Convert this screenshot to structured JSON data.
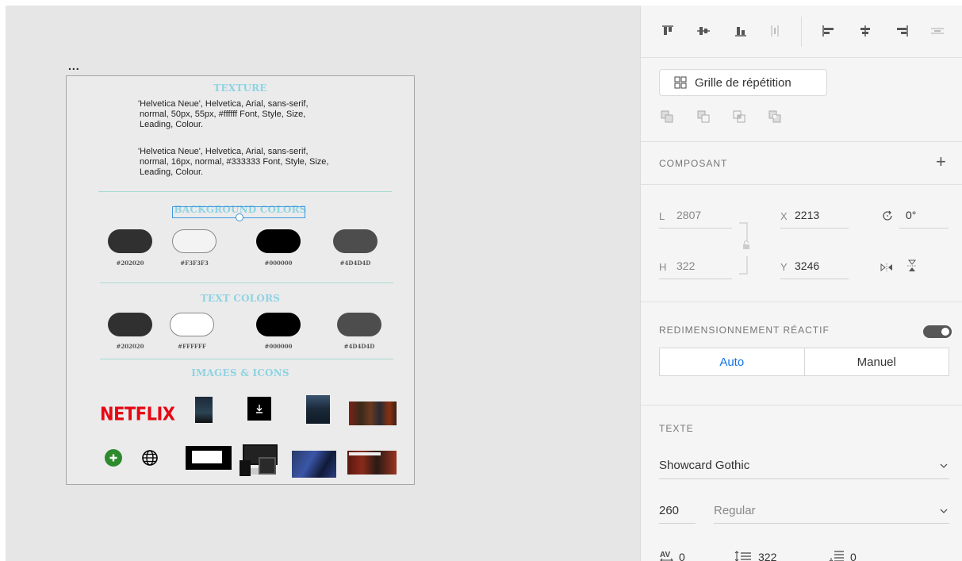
{
  "canvas": {
    "more_label": "...",
    "texture": {
      "title": "TEXTURE",
      "line1": "'Helvetica Neue', Helvetica, Arial, sans-serif,",
      "line2": "normal, 50px, 55px, #ffffff Font, Style, Size,",
      "line3": "Leading, Colour.",
      "line4": "'Helvetica Neue', Helvetica, Arial, sans-serif,",
      "line5": "normal, 16px, normal, #333333 Font, Style, Size,",
      "line6": "Leading, Colour."
    },
    "background_colors": {
      "title": "BACKGROUND COLORS",
      "swatches": [
        {
          "hex": "#202020",
          "color": "#303030"
        },
        {
          "hex": "#F3F3F3",
          "color": "#f3f3f3"
        },
        {
          "hex": "#000000",
          "color": "#000000"
        },
        {
          "hex": "#4D4D4D",
          "color": "#4d4d4d"
        }
      ]
    },
    "text_colors": {
      "title": "TEXT COLORS",
      "swatches": [
        {
          "hex": "#202020",
          "color": "#303030"
        },
        {
          "hex": "#FFFFFF",
          "color": "#ffffff"
        },
        {
          "hex": "#000000",
          "color": "#000000"
        },
        {
          "hex": "#4D4D4D",
          "color": "#4d4d4d"
        }
      ]
    },
    "images_icons": {
      "title": "IMAGES & ICONS",
      "logo_text": "NETFLIX"
    },
    "selection_color": "#3d98e0"
  },
  "panel": {
    "align_icons": [
      "align-top-icon",
      "align-middle-icon",
      "align-bottom-icon",
      "distribute-vertical-icon",
      "align-left-icon",
      "align-center-icon",
      "align-right-icon",
      "distribute-horizontal-icon"
    ],
    "repeat_grid_label": "Grille de répétition",
    "component_label": "COMPOSANT",
    "component_add": "+",
    "width_label": "L",
    "width_value": "2807",
    "height_label": "H",
    "height_value": "322",
    "x_label": "X",
    "x_value": "2213",
    "y_label": "Y",
    "y_value": "3246",
    "rotation_value": "0°",
    "responsive_label": "REDIMENSIONNEMENT RÉACTIF",
    "responsive_on": true,
    "seg_auto": "Auto",
    "seg_manual": "Manuel",
    "text_label": "TEXTE",
    "font_family": "Showcard Gothic",
    "font_size": "260",
    "font_weight": "Regular",
    "char_spacing": "0",
    "line_spacing": "322",
    "para_spacing": "0",
    "accent_color": "#1473e6"
  }
}
